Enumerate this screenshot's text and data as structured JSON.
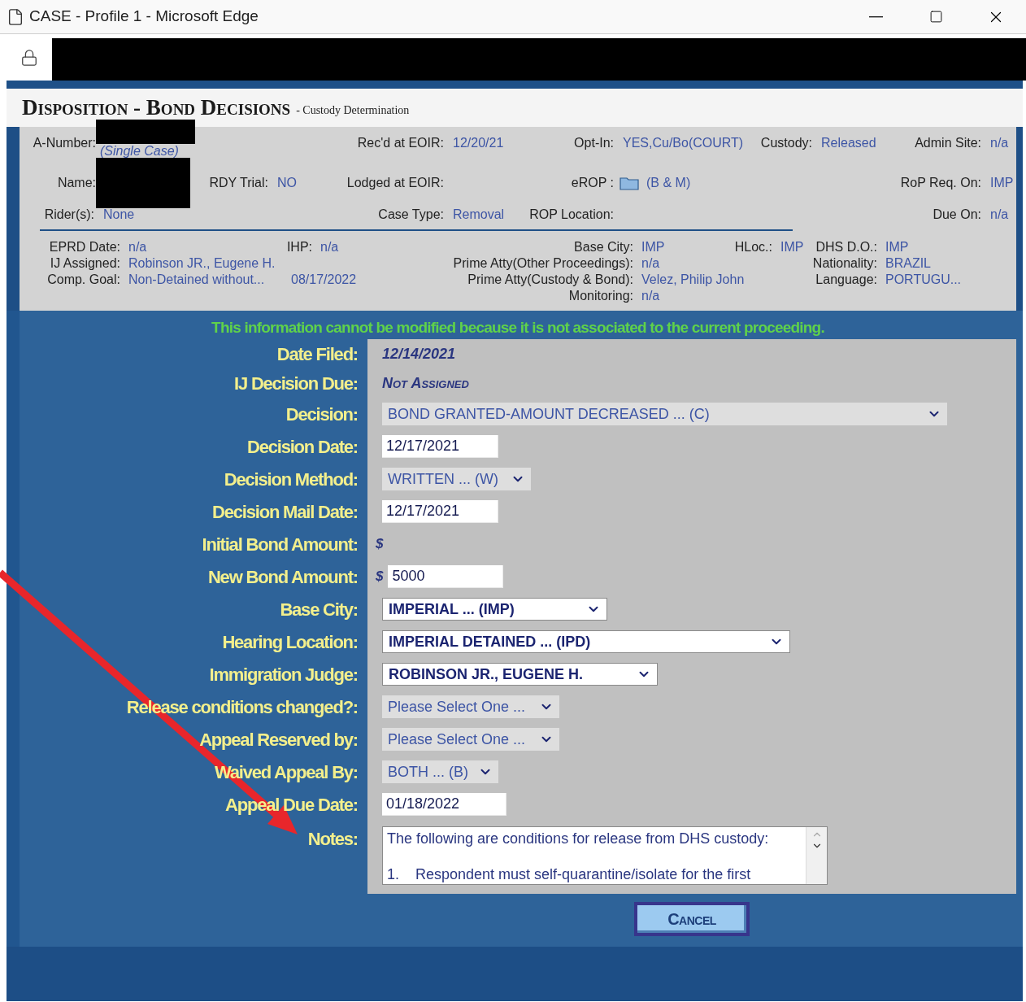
{
  "window": {
    "title": "CASE - Profile 1 - Microsoft Edge"
  },
  "page": {
    "title": "Disposition - Bond Decisions",
    "subtitle": "- Custody Determination"
  },
  "case_info": {
    "rows": [
      {
        "fields": [
          {
            "kind": "redacted",
            "label": "A-Number:",
            "note": "(Single Case)"
          },
          {
            "kind": "text",
            "label": "Rec'd at EOIR:",
            "value": "12/20/21"
          },
          {
            "kind": "text",
            "label": "Opt-In:",
            "value": "YES,Cu/Bo(COURT)"
          },
          {
            "kind": "text",
            "label": "Custody:",
            "value": "Released"
          },
          {
            "kind": "text",
            "label": "Admin Site:",
            "value": "n/a"
          }
        ]
      },
      {
        "fields": [
          {
            "kind": "redacted",
            "label": "Name:"
          },
          {
            "kind": "text",
            "label": "RDY Trial:",
            "value": "NO"
          },
          {
            "kind": "text",
            "label": "Lodged at EOIR:"
          },
          {
            "kind": "folder",
            "label": "eROP :",
            "value": "(B & M)"
          },
          {
            "kind": "text",
            "label": "RoP Req. On:",
            "value": "IMP"
          }
        ]
      },
      {
        "fields": [
          {
            "kind": "text",
            "label": "Rider(s):",
            "value": "None"
          },
          {
            "kind": "text",
            "label": "Case Type:",
            "value": "Removal"
          },
          {
            "kind": "text",
            "label": "ROP Location:"
          },
          {
            "kind": "text",
            "label": "Due On:",
            "value": "n/a"
          }
        ]
      }
    ],
    "details": [
      {
        "lines": [
          {
            "fields": [
              {
                "label": "EPRD Date:",
                "value": "n/a"
              },
              {
                "label": "IHP:",
                "value": "n/a"
              }
            ]
          },
          {
            "fields": [
              {
                "label": "IJ Assigned:",
                "value": "Robinson JR., Eugene H."
              }
            ]
          },
          {
            "fields": [
              {
                "label": "Comp. Goal:",
                "value": "Non-Detained without..."
              },
              {
                "value": "08/17/2022"
              }
            ]
          }
        ]
      },
      {
        "lines": [
          {
            "fields": [
              {
                "label": "Base City:",
                "value": "IMP"
              },
              {
                "label": "HLoc.:",
                "value": "IMP"
              }
            ]
          },
          {
            "fields": [
              {
                "label": "Prime Atty(Other Proceedings):",
                "value": "n/a"
              }
            ]
          },
          {
            "fields": [
              {
                "label": "Prime Atty(Custody & Bond):",
                "value": "Velez, Philip John"
              }
            ]
          },
          {
            "fields": [
              {
                "label": "Monitoring:",
                "value": "n/a"
              }
            ]
          }
        ]
      },
      {
        "lines": [
          {
            "fields": [
              {
                "label": "DHS D.O.:",
                "value": "IMP"
              }
            ]
          },
          {
            "fields": [
              {
                "label": "Nationality:",
                "value": "BRAZIL"
              }
            ]
          },
          {
            "fields": [
              {
                "label": "Language:",
                "value": "PORTUGU..."
              }
            ]
          }
        ]
      }
    ]
  },
  "notice": "This information cannot be modified because it is not associated to the current proceeding.",
  "form": {
    "fields": [
      {
        "label": "Date Filed:",
        "kind": "text",
        "value": "12/14/2021"
      },
      {
        "label": "IJ Decision Due:",
        "kind": "caps_text",
        "value": "Not Assigned"
      },
      {
        "label": "Decision:",
        "kind": "select",
        "value": "BOND GRANTED-AMOUNT DECREASED ... (C)",
        "disabled": true
      },
      {
        "label": "Decision Date:",
        "kind": "input",
        "value": "12/17/2021"
      },
      {
        "label": "Decision Method:",
        "kind": "select",
        "value": "WRITTEN ... (W)",
        "disabled": true
      },
      {
        "label": "Decision Mail Date:",
        "kind": "input",
        "value": "12/17/2021"
      },
      {
        "label": "Initial Bond Amount:",
        "kind": "currency",
        "currency": "$"
      },
      {
        "label": "New Bond Amount:",
        "kind": "money",
        "currency": "$",
        "value": "5000"
      },
      {
        "label": "Base City:",
        "kind": "select",
        "value": "IMPERIAL ... (IMP)",
        "disabled": false
      },
      {
        "label": "Hearing Location:",
        "kind": "select",
        "value": "IMPERIAL DETAINED ... (IPD)",
        "disabled": false
      },
      {
        "label": "Immigration Judge:",
        "kind": "select",
        "value": "ROBINSON JR., EUGENE H.",
        "disabled": false
      },
      {
        "label": "Release conditions changed?:",
        "kind": "select",
        "value": "Please Select One ...",
        "disabled": true
      },
      {
        "label": "Appeal Reserved by:",
        "kind": "select",
        "value": "Please Select One ...",
        "disabled": true
      },
      {
        "label": "Waived Appeal By:",
        "kind": "select",
        "value": "BOTH ... (B)",
        "disabled": true
      },
      {
        "label": "Appeal Due Date:",
        "kind": "input",
        "value": "01/18/2022"
      },
      {
        "label": "Notes:",
        "kind": "textarea",
        "lines": [
          "The following are conditions for release from DHS custody:",
          "1.    Respondent must self-quarantine/isolate for the first"
        ]
      }
    ]
  },
  "buttons": [
    {
      "label": "Cancel"
    }
  ]
}
